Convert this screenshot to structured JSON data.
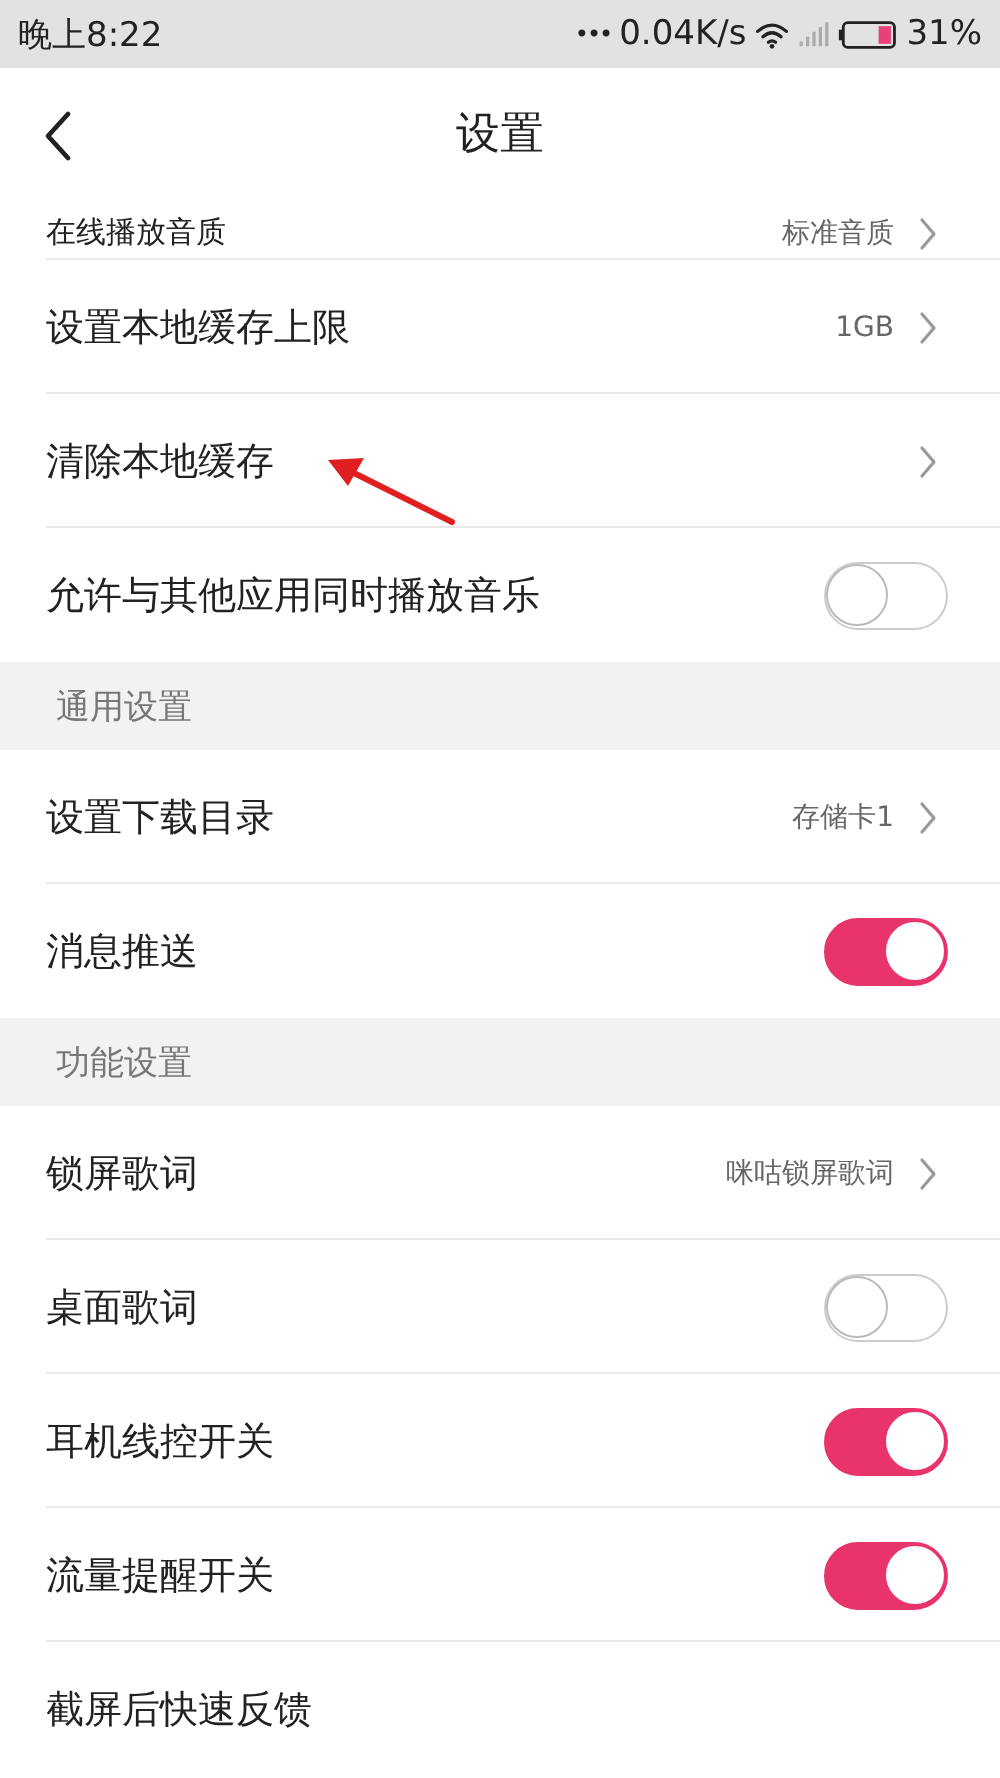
{
  "status_bar": {
    "time": "晚上8:22",
    "dots": "•••",
    "speed": "0.04K/s",
    "battery": "31%"
  },
  "header": {
    "title": "设置"
  },
  "sections": [
    {
      "kind": "plain",
      "items": [
        {
          "kind": "link",
          "label": "在线播放音质",
          "value": "标准音质",
          "partial": true
        },
        {
          "kind": "link",
          "label": "设置本地缓存上限",
          "value": "1GB"
        },
        {
          "kind": "link",
          "label": "清除本地缓存"
        },
        {
          "kind": "toggle",
          "label": "允许与其他应用同时播放音乐",
          "on": false
        }
      ]
    },
    {
      "kind": "titled",
      "title": "通用设置",
      "items": [
        {
          "kind": "link",
          "label": "设置下载目录",
          "value": "存储卡1"
        },
        {
          "kind": "toggle",
          "label": "消息推送",
          "on": true
        }
      ]
    },
    {
      "kind": "titled",
      "title": "功能设置",
      "items": [
        {
          "kind": "link",
          "label": "锁屏歌词",
          "value": "咪咕锁屏歌词"
        },
        {
          "kind": "toggle",
          "label": "桌面歌词",
          "on": false
        },
        {
          "kind": "toggle",
          "label": "耳机线控开关",
          "on": true
        },
        {
          "kind": "toggle",
          "label": "流量提醒开关",
          "on": true
        },
        {
          "kind": "plain",
          "label": "截屏后快速反馈"
        }
      ]
    }
  ]
}
